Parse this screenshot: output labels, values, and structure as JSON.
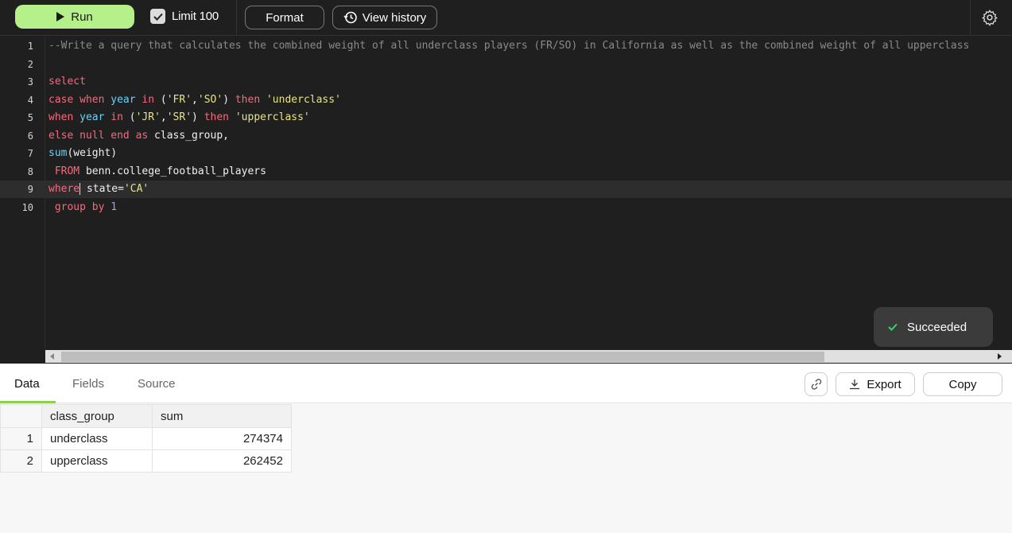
{
  "toolbar": {
    "run_label": "Run",
    "limit_label": "Limit 100",
    "format_label": "Format",
    "history_label": "View history"
  },
  "editor": {
    "lines": [
      {
        "n": "1",
        "html": "<span class=\"cmt\">--Write a query that calculates the combined weight of all underclass players (FR/SO) in California as well as the combined weight of all upperclass</span>"
      },
      {
        "n": "2",
        "html": ""
      },
      {
        "n": "3",
        "html": "<span class=\"kw\">select</span>"
      },
      {
        "n": "4",
        "html": "<span class=\"kw\">case when</span> <span class=\"fn\">year</span> <span class=\"kw\">in</span> (<span class=\"str\">'FR'</span>,<span class=\"str\">'SO'</span>) <span class=\"kw\">then</span> <span class=\"str\">'underclass'</span>"
      },
      {
        "n": "5",
        "html": "<span class=\"kw\">when</span> <span class=\"fn\">year</span> <span class=\"kw\">in</span> (<span class=\"str\">'JR'</span>,<span class=\"str\">'SR'</span>) <span class=\"kw\">then</span> <span class=\"str\">'upperclass'</span>"
      },
      {
        "n": "6",
        "html": "<span class=\"kw\">else null end as</span> class_group,"
      },
      {
        "n": "7",
        "html": "<span class=\"fn\">sum</span>(weight)"
      },
      {
        "n": "8",
        "html": " <span class=\"kw\">FROM</span> benn.college_football_players"
      },
      {
        "n": "9",
        "html": "<span class=\"kw\">where</span><span class=\"cursor\"></span> state=<span class=\"str\">'CA'</span>"
      },
      {
        "n": "10",
        "html": " <span class=\"kw\">group by</span> <span class=\"num\">1</span>"
      }
    ],
    "active_line": "9"
  },
  "toast": {
    "label": "Succeeded"
  },
  "results": {
    "tabs": [
      "Data",
      "Fields",
      "Source"
    ],
    "export_label": "Export",
    "copy_label": "Copy",
    "columns": [
      "class_group",
      "sum"
    ],
    "rows": [
      {
        "idx": "1",
        "class_group": "underclass",
        "sum": "274374"
      },
      {
        "idx": "2",
        "class_group": "upperclass",
        "sum": "262452"
      }
    ]
  },
  "colors": {
    "run_button": "#b6f08b",
    "tab_underline": "#8fcf4e",
    "success_check": "#3ecf6a"
  },
  "icons": [
    "play-icon",
    "checkbox-icon",
    "history-icon",
    "gear-icon",
    "check-icon",
    "link-icon",
    "download-icon"
  ]
}
